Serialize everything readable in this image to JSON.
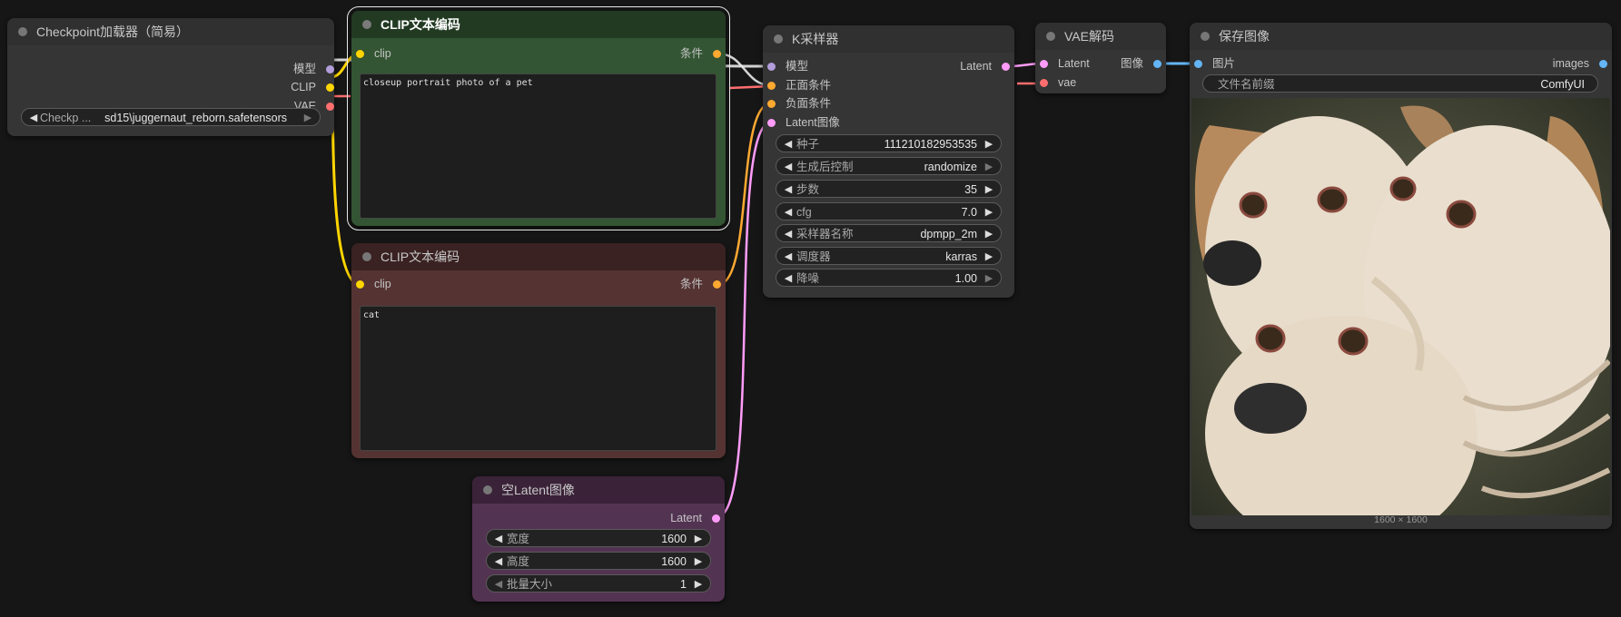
{
  "colors": {
    "model": "#b39ddb",
    "clip": "#ffd500",
    "vae": "#ff6e6e",
    "conditioning": "#ffa931",
    "latent": "#ff9cf9",
    "image": "#64b5f6"
  },
  "checkpoint": {
    "title": "Checkpoint加载器（简易）",
    "out_model": "模型",
    "out_clip": "CLIP",
    "out_vae": "VAE",
    "w_label": "Checkp ...",
    "w_value": "sd15\\juggernaut_reborn.safetensors"
  },
  "clip_pos": {
    "title": "CLIP文本编码",
    "in_clip": "clip",
    "out": "条件",
    "text": "closeup portrait photo of a pet"
  },
  "clip_neg": {
    "title": "CLIP文本编码",
    "in_clip": "clip",
    "out": "条件",
    "text": "cat"
  },
  "empty_latent": {
    "title": "空Latent图像",
    "out": "Latent",
    "widgets": [
      {
        "label": "宽度",
        "value": "1600"
      },
      {
        "label": "高度",
        "value": "1600"
      },
      {
        "label": "批量大小",
        "value": "1"
      }
    ]
  },
  "ksampler": {
    "title": "K采样器",
    "inputs": [
      "模型",
      "正面条件",
      "负面条件",
      "Latent图像"
    ],
    "out": "Latent",
    "widgets": [
      {
        "label": "种子",
        "value": "111210182953535"
      },
      {
        "label": "生成后控制",
        "value": "randomize"
      },
      {
        "label": "步数",
        "value": "35"
      },
      {
        "label": "cfg",
        "value": "7.0"
      },
      {
        "label": "采样器名称",
        "value": "dpmpp_2m"
      },
      {
        "label": "调度器",
        "value": "karras"
      },
      {
        "label": "降噪",
        "value": "1.00"
      }
    ]
  },
  "vae_decode": {
    "title": "VAE解码",
    "in_latent": "Latent",
    "in_vae": "vae",
    "out": "图像"
  },
  "save_image": {
    "title": "保存图像",
    "in_images": "图片",
    "out": "images",
    "w_label": "文件名前缀",
    "w_value": "ComfyUI",
    "caption": "1600 × 1600"
  }
}
